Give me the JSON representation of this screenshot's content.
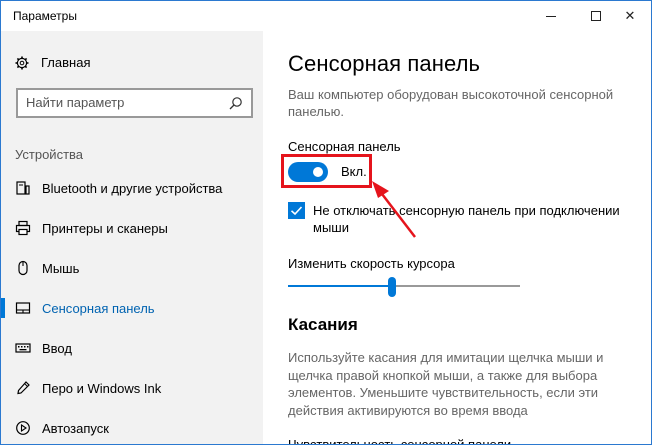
{
  "window": {
    "title": "Параметры",
    "close_glyph": "✕"
  },
  "sidebar": {
    "home_label": "Главная",
    "search_placeholder": "Найти параметр",
    "section_label": "Устройства",
    "items": [
      {
        "label": "Bluetooth и другие устройства",
        "icon": "bluetooth-device-icon",
        "active": false
      },
      {
        "label": "Принтеры и сканеры",
        "icon": "printer-icon",
        "active": false
      },
      {
        "label": "Мышь",
        "icon": "mouse-icon",
        "active": false
      },
      {
        "label": "Сенсорная панель",
        "icon": "touchpad-icon",
        "active": true
      },
      {
        "label": "Ввод",
        "icon": "keyboard-icon",
        "active": false
      },
      {
        "label": "Перо и Windows Ink",
        "icon": "pen-icon",
        "active": false
      },
      {
        "label": "Автозапуск",
        "icon": "autoplay-icon",
        "active": false
      }
    ]
  },
  "main": {
    "title": "Сенсорная панель",
    "description": "Ваш компьютер оборудован высокоточной сенсорной панелью.",
    "touchpad_label": "Сенсорная панель",
    "toggle_state": "Вкл.",
    "toggle_on": true,
    "keep_on_checkbox_label": "Не отключать сенсорную панель при подключении мыши",
    "keep_on_checked": true,
    "cursor_speed_label": "Изменить скорость курсора",
    "cursor_speed_fraction": 0.45,
    "taps_heading": "Касания",
    "taps_description": "Используйте касания для имитации щелчка мыши и щелчка правой кнопкой мыши, а также для выбора элементов. Уменьшите чувствительность, если эти действия активируются во время ввода",
    "sensitivity_label_cutoff": "Чувствительность сенсорной панели"
  },
  "colors": {
    "accent": "#0078d7",
    "highlight": "#e5141c",
    "sidebar_bg": "#f2f2f2"
  }
}
